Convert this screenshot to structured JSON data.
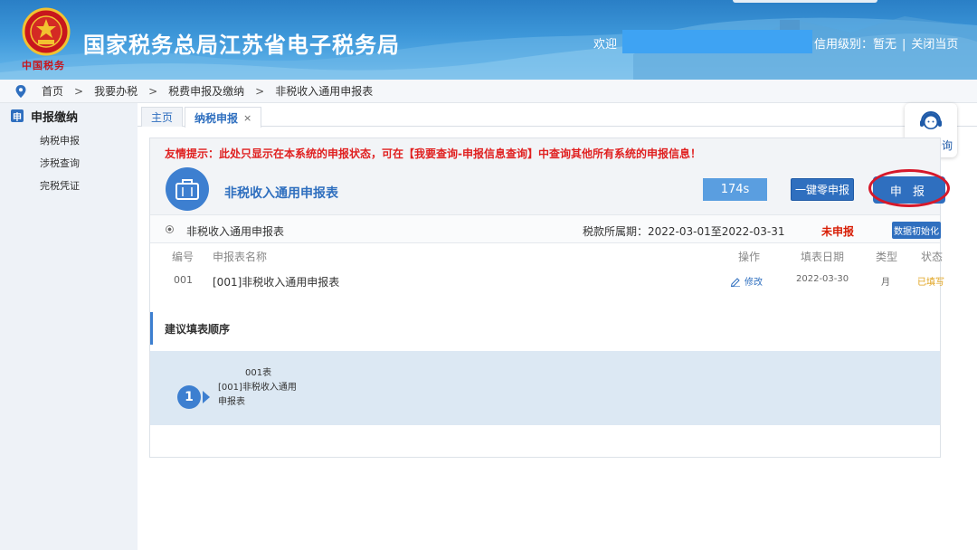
{
  "header": {
    "site_title": "国家税务总局江苏省电子税务局",
    "emblem_sub": "中国税务",
    "welcome": "欢迎",
    "credit_label": "信用级别：暂无",
    "close_page": "关闭当页"
  },
  "breadcrumb": {
    "items": [
      "首页",
      "我要办税",
      "税费申报及缴纳",
      "非税收入通用申报表"
    ],
    "separator": ">"
  },
  "sidebar": {
    "section": "申报缴纳",
    "section_icon": "申",
    "items": [
      {
        "label": "纳税申报"
      },
      {
        "label": "涉税查询"
      },
      {
        "label": "完税凭证"
      }
    ]
  },
  "tabs": [
    {
      "label": "主页",
      "active": false
    },
    {
      "label": "纳税申报",
      "active": true,
      "close": "×"
    }
  ],
  "assistant": {
    "label": "智能咨询"
  },
  "panel": {
    "notice": "友情提示：此处只显示在本系统的申报状态，可在【我要查询-申报信息查询】中查询其他所有系统的申报信息！",
    "form_title": "非税收入通用申报表",
    "timer": "174s",
    "zero_button": "一键零申报",
    "submit_button": "申 报",
    "summary": {
      "name": "非税收入通用申报表",
      "period": "税款所属期：2022-03-01至2022-03-31",
      "status": "未申报",
      "init_button": "数据初始化"
    },
    "table": {
      "headers": {
        "no": "编号",
        "name": "申报表名称",
        "op": "操作",
        "date": "填表日期",
        "type": "类型",
        "status": "状态"
      },
      "rows": [
        {
          "no": "001",
          "name": "[001]非税收入通用申报表",
          "op": "修改",
          "date": "2022-03-30",
          "type": "月",
          "status": "已填写"
        }
      ]
    },
    "order": {
      "title": "建议填表顺序",
      "steps": [
        {
          "num": "1",
          "line1": "001表",
          "line2": "[001]非税收入通用",
          "line3": "申报表"
        }
      ]
    }
  },
  "colors": {
    "primary": "#2f6fbf",
    "header_bg": "#3d97d9",
    "notice_red": "#e02020",
    "status_unfiled": "#d81e06",
    "status_filled": "#e0a21b",
    "highlight_circle": "#d6182a"
  }
}
